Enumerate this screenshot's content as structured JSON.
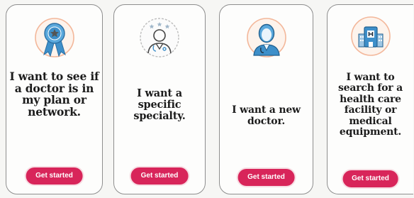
{
  "colors": {
    "accent": "#d8255a",
    "icon_ring": "#f3b79a",
    "icon_blue": "#3e8fc9",
    "card_border": "#8e8e8e",
    "text": "#1c1c1c"
  },
  "cards": [
    {
      "icon": "award-ribbon-icon",
      "title": "I want to see if a doctor is in my plan or network.",
      "button": "Get started"
    },
    {
      "icon": "doctor-rating-icon",
      "title": "I want a specific specialty.",
      "button": "Get started"
    },
    {
      "icon": "new-doctor-icon",
      "title": "I want a new doctor.",
      "button": "Get started"
    },
    {
      "icon": "hospital-facility-icon",
      "title": "I want to search for a health care facility or medical equipment.",
      "button": "Get started"
    }
  ]
}
